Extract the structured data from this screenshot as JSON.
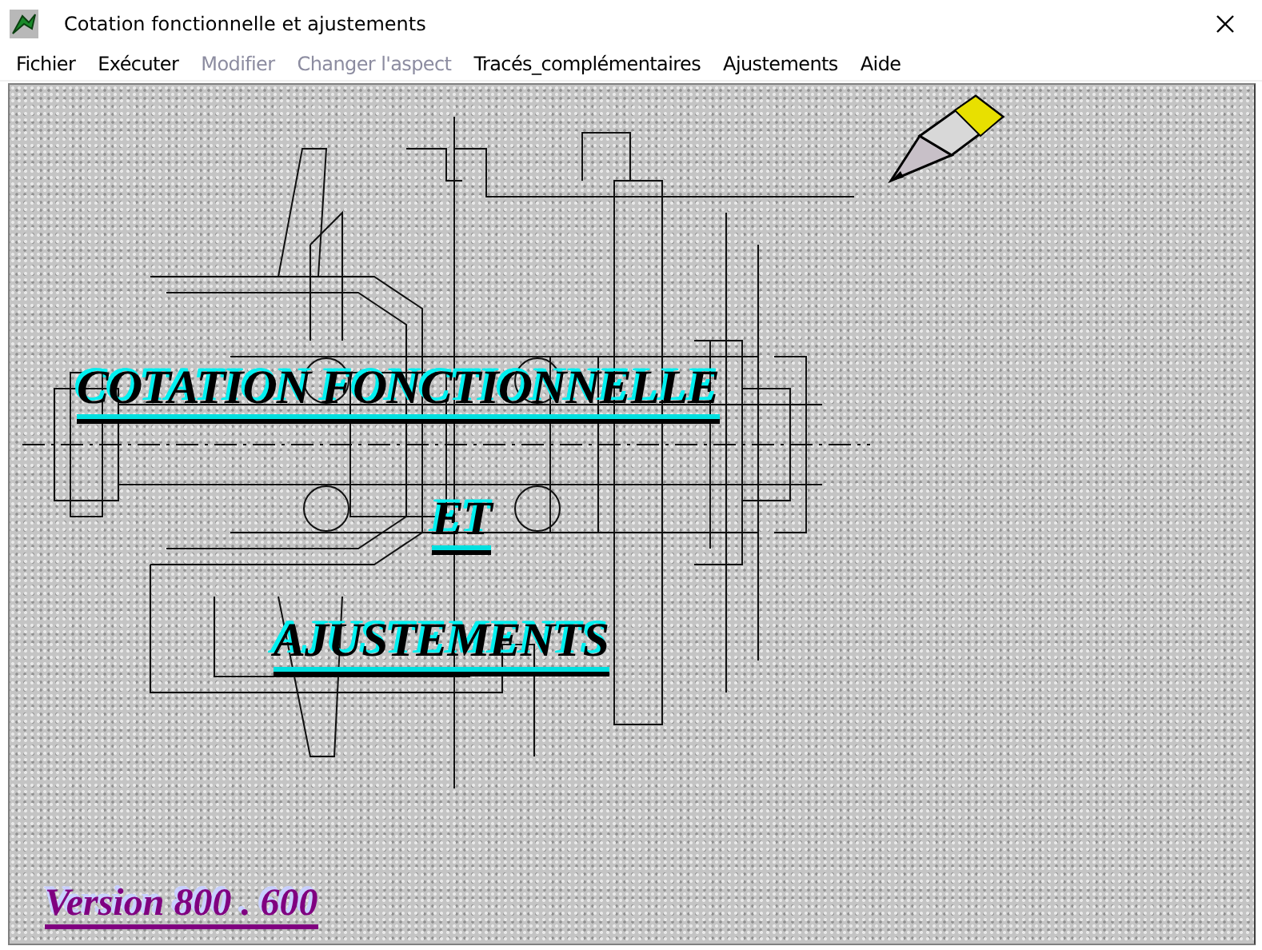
{
  "window": {
    "title": "Cotation  fonctionnelle  et  ajustements"
  },
  "menu": [
    {
      "label": "Fichier",
      "disabled": false
    },
    {
      "label": "Exécuter",
      "disabled": false
    },
    {
      "label": "Modifier",
      "disabled": true
    },
    {
      "label": "Changer l'aspect",
      "disabled": true
    },
    {
      "label": "Tracés_complémentaires",
      "disabled": false
    },
    {
      "label": "Ajustements",
      "disabled": false
    },
    {
      "label": "Aide",
      "disabled": false
    }
  ],
  "splash": {
    "title_lines": [
      "COTATION  FONCTIONNELLE",
      "ET",
      "AJUSTEMENTS"
    ],
    "version": "Version 800 . 600"
  }
}
